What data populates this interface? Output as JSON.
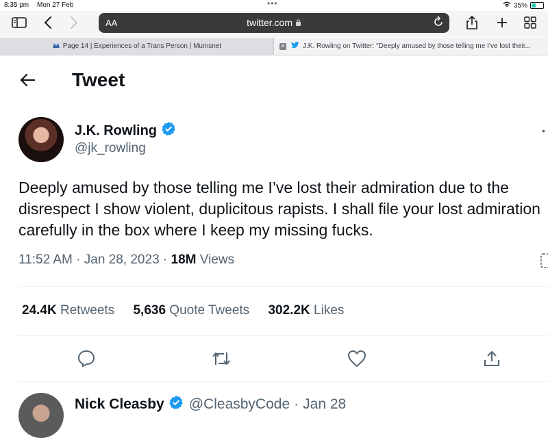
{
  "status_bar": {
    "time": "8:35 pm",
    "date": "Mon 27 Feb",
    "dots": "•••",
    "battery_percent": "35%"
  },
  "browser": {
    "aa_label": "AA",
    "url": "twitter.com",
    "tabs": [
      {
        "label": "Page 14 | Experiences of a Trans Person | Mumsnet"
      },
      {
        "label": "J.K. Rowling on Twitter: \"Deeply amused by those telling me I’ve lost their..."
      }
    ]
  },
  "page": {
    "title": "Tweet"
  },
  "tweet": {
    "author_name": "J.K. Rowling",
    "author_handle": "@jk_rowling",
    "text": "Deeply amused by those telling me I’ve lost their admiration due to the disrespect I show violent, duplicitous rapists. I shall file your lost admiration carefully in the box where I keep my missing fucks.",
    "time": "11:52 AM",
    "date": "Jan 28, 2023",
    "views_count": "18M",
    "views_label": "Views",
    "retweets_count": "24.4K",
    "retweets_label": "Retweets",
    "quotes_count": "5,636",
    "quotes_label": "Quote Tweets",
    "likes_count": "302.2K",
    "likes_label": "Likes"
  },
  "reply": {
    "author_name": "Nick Cleasby",
    "author_handle": "@CleasbyCode",
    "date": "Jan 28"
  },
  "colors": {
    "verified": "#1d9bf0",
    "secondary_text": "#536471",
    "address_bar": "#3a3a3c"
  }
}
